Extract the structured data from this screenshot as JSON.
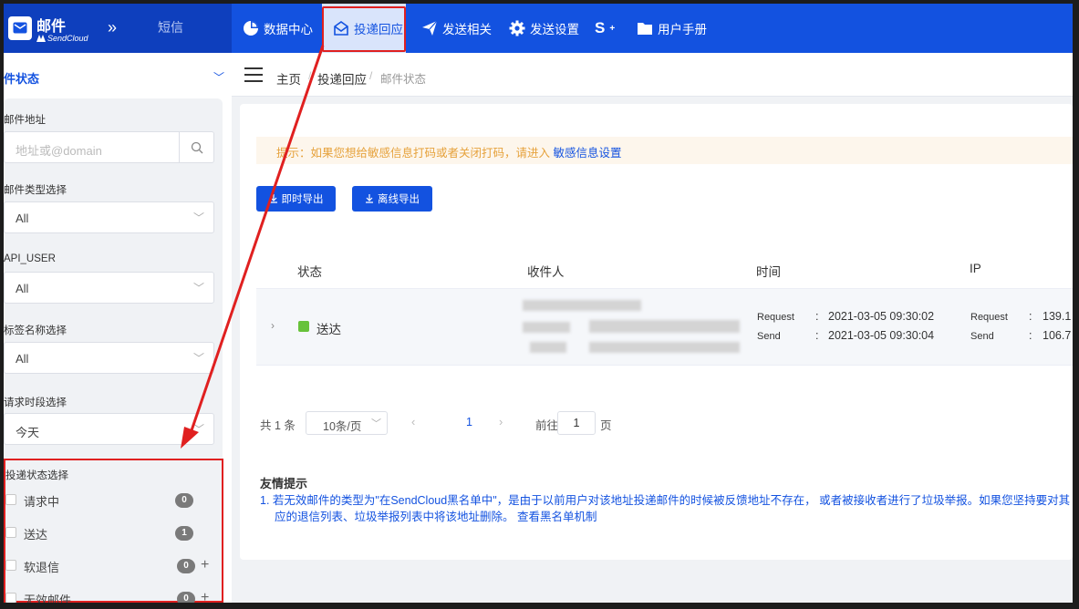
{
  "brand": {
    "title": "邮件",
    "subtitle": "SendCloud",
    "sms": "短信"
  },
  "nav": [
    {
      "label": "数据中心",
      "icon": "pie-chart-icon"
    },
    {
      "label": "投递回应",
      "icon": "envelope-open-icon"
    },
    {
      "label": "发送相关",
      "icon": "paper-plane-icon"
    },
    {
      "label": "发送设置",
      "icon": "gear-icon"
    },
    {
      "label": "",
      "icon": "s-plus-icon"
    },
    {
      "label": "用户手册",
      "icon": "folder-icon"
    }
  ],
  "sidebar": {
    "section_title": "件状态",
    "address_label": "邮件地址",
    "address_placeholder": "地址或@domain",
    "type_label": "邮件类型选择",
    "type_value": "All",
    "apiuser_label": "API_USER",
    "apiuser_value": "All",
    "tag_label": "标签名称选择",
    "tag_value": "All",
    "period_label": "请求时段选择",
    "period_value": "今天",
    "status_label": "投递状态选择",
    "statuses": [
      {
        "label": "请求中",
        "count": "0"
      },
      {
        "label": "送达",
        "count": "1"
      },
      {
        "label": "软退信",
        "count": "0"
      },
      {
        "label": "无效邮件",
        "count": "0"
      }
    ]
  },
  "breadcrumb": {
    "home": "主页",
    "sep": "/",
    "parent": "投递回应",
    "current": "邮件状态"
  },
  "tip": {
    "prefix": "提示：如果您想给敏感信息打码或者关闭打码，请进入",
    "link": "敏感信息设置"
  },
  "buttons": {
    "export_now": "即时导出",
    "export_offline": "离线导出"
  },
  "table": {
    "headers": {
      "status": "状态",
      "recipient": "收件人",
      "time": "时间",
      "ip": "IP"
    },
    "row": {
      "status": "送达",
      "request_key": "Request",
      "request_time": "2021-03-05 09:30:02",
      "send_key": "Send",
      "send_time": "2021-03-05 09:30:04",
      "colon": ":",
      "ip_request": "139.1",
      "ip_send": "106.7"
    }
  },
  "pagination": {
    "total": "共 1 条",
    "page_size": "10条/页",
    "page": "1",
    "goto_label": "前往",
    "goto_value": "1",
    "page_suffix": "页"
  },
  "notes": {
    "title": "友情提示",
    "line1": "1. 若无效邮件的类型为\"在SendCloud黑名单中\"，是由于以前用户对该地址投递邮件的时候被反馈地址不存在， 或者被接收者进行了垃圾举报。如果您坚持要对其",
    "line2": "应的退信列表、垃圾举报列表中将该地址删除。",
    "link": "查看黑名单机制"
  },
  "colors": {
    "primary": "#1352e0",
    "highlight": "#e02020",
    "success": "#67c23a",
    "warning": "#e6a23c"
  }
}
